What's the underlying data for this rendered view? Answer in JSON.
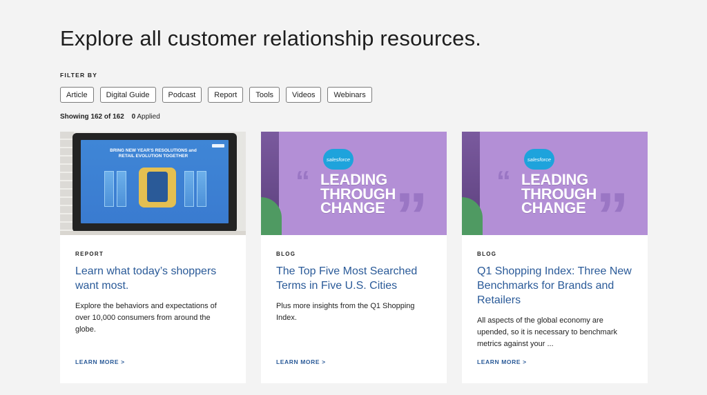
{
  "page": {
    "title": "Explore all customer relationship resources."
  },
  "filter": {
    "label": "FILTER BY",
    "chips": [
      "Article",
      "Digital Guide",
      "Podcast",
      "Report",
      "Tools",
      "Videos",
      "Webinars"
    ]
  },
  "status": {
    "showing": "Showing 162 of 162",
    "applied_count": "0",
    "applied_label": "Applied"
  },
  "cards": [
    {
      "eyebrow": "REPORT",
      "title": "Learn what today’s shoppers want most.",
      "description": "Explore the behaviors and expectations of over 10,000 consumers from around the globe.",
      "cta": "LEARN MORE >",
      "image_text": "BRING NEW YEAR'S RESOLUTIONS and RETAIL EVOLUTION TOGETHER"
    },
    {
      "eyebrow": "BLOG",
      "title": "The Top Five Most Searched Terms in Five U.S. Cities",
      "description": "Plus more insights from the Q1 Shopping Index.",
      "cta": "LEARN MORE >",
      "image_logo": "salesforce",
      "image_headline": [
        "LEADING",
        "THROUGH",
        "CHANGE"
      ]
    },
    {
      "eyebrow": "BLOG",
      "title": "Q1 Shopping Index: Three New Benchmarks for Brands and Retailers",
      "description": "All aspects of the global economy are upended, so it is necessary to benchmark metrics against your ...",
      "cta": "LEARN MORE >",
      "image_logo": "salesforce",
      "image_headline": [
        "LEADING",
        "THROUGH",
        "CHANGE"
      ]
    }
  ]
}
